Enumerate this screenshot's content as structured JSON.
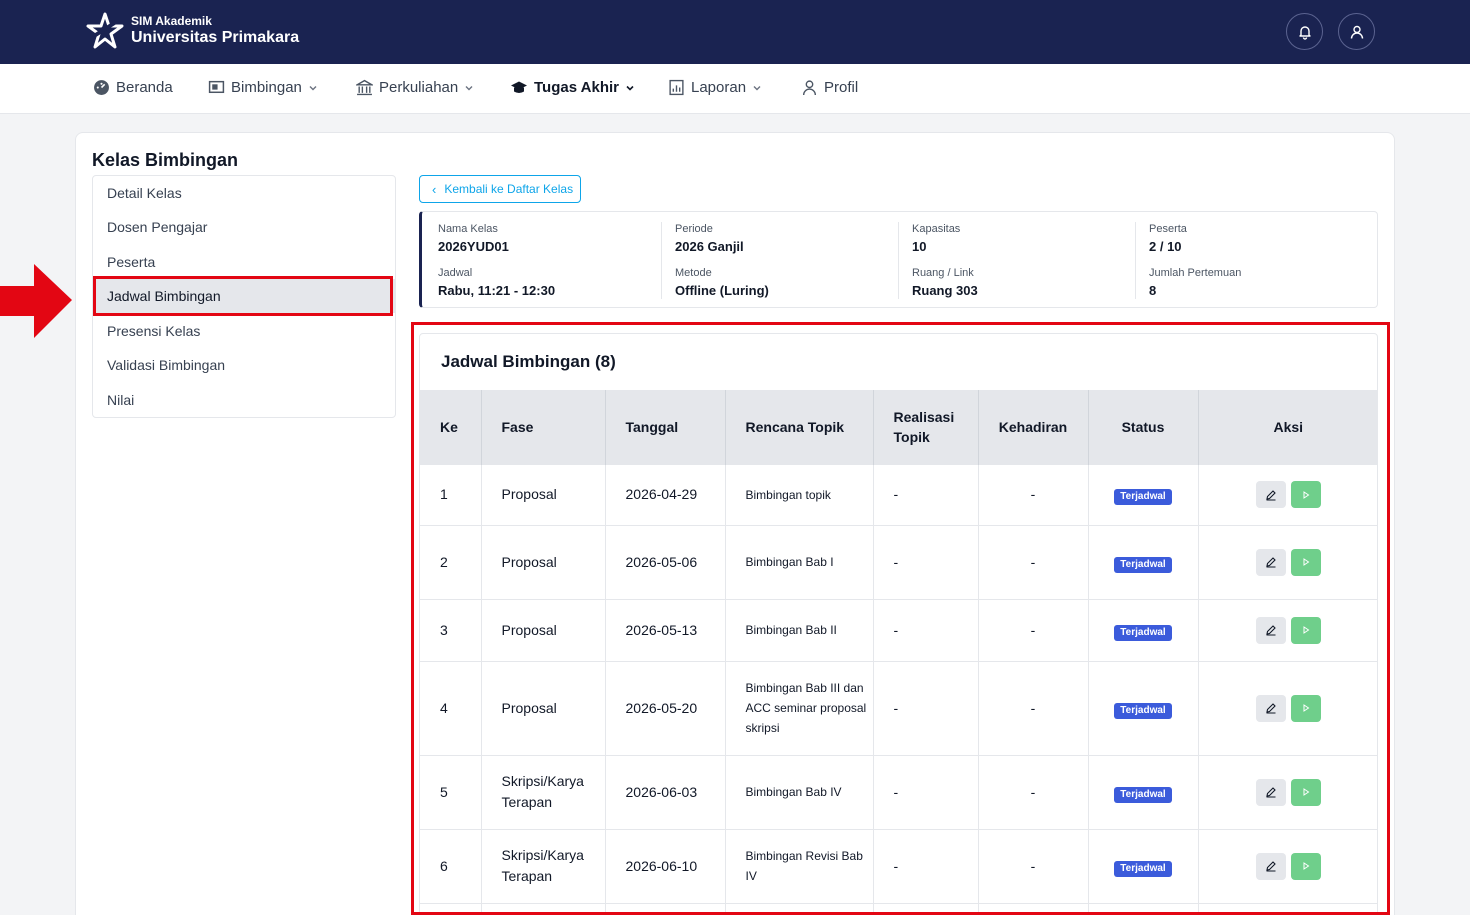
{
  "header": {
    "app_sub": "SIM Akademik",
    "app_name": "Universitas Primakara",
    "notification_icon": "bell-icon",
    "user_icon": "user-icon"
  },
  "nav": {
    "items": [
      {
        "label": "Beranda",
        "icon": "dashboard-icon"
      },
      {
        "label": "Bimbingan",
        "icon": "presentation-icon"
      },
      {
        "label": "Perkuliahan",
        "icon": "building-icon"
      },
      {
        "label": "Tugas Akhir",
        "icon": "graduation-cap-icon",
        "active": true
      },
      {
        "label": "Laporan",
        "icon": "report-icon"
      },
      {
        "label": "Profil",
        "icon": "person-icon"
      }
    ]
  },
  "page": {
    "title": "Kelas Bimbingan",
    "back_label": "Kembali ke Daftar Kelas"
  },
  "side_menu": {
    "items": [
      {
        "label": "Detail Kelas"
      },
      {
        "label": "Dosen Pengajar"
      },
      {
        "label": "Peserta"
      },
      {
        "label": "Jadwal Bimbingan",
        "active": true
      },
      {
        "label": "Presensi Kelas"
      },
      {
        "label": "Validasi Bimbingan"
      },
      {
        "label": "Nilai"
      }
    ]
  },
  "info": {
    "fields": [
      {
        "label": "Nama Kelas",
        "value": "2026YUD01"
      },
      {
        "label": "Periode",
        "value": "2026 Ganjil"
      },
      {
        "label": "Kapasitas",
        "value": "10"
      },
      {
        "label": "Peserta",
        "value": "2 / 10"
      },
      {
        "label": "Jadwal",
        "value": "Rabu, 11:21 - 12:30"
      },
      {
        "label": "Metode",
        "value": "Offline (Luring)"
      },
      {
        "label": "Ruang / Link",
        "value": "Ruang 303"
      },
      {
        "label": "Jumlah Pertemuan",
        "value": "8"
      }
    ]
  },
  "schedule": {
    "title": "Jadwal Bimbingan (8)",
    "columns": [
      "Ke",
      "Fase",
      "Tanggal",
      "Rencana Topik",
      "Realisasi Topik",
      "Kehadiran",
      "Status",
      "Aksi"
    ],
    "rows": [
      {
        "ke": "1",
        "fase": "Proposal",
        "tanggal": "2026-04-29",
        "rencana": "Bimbingan topik",
        "realisasi": "-",
        "kehadiran": "-",
        "status": "Terjadwal"
      },
      {
        "ke": "2",
        "fase": "Proposal",
        "tanggal": "2026-05-06",
        "rencana": "Bimbingan Bab I",
        "realisasi": "-",
        "kehadiran": "-",
        "status": "Terjadwal"
      },
      {
        "ke": "3",
        "fase": "Proposal",
        "tanggal": "2026-05-13",
        "rencana": "Bimbingan Bab II",
        "realisasi": "-",
        "kehadiran": "-",
        "status": "Terjadwal"
      },
      {
        "ke": "4",
        "fase": "Proposal",
        "tanggal": "2026-05-20",
        "rencana": "Bimbingan Bab III dan ACC seminar proposal skripsi",
        "realisasi": "-",
        "kehadiran": "-",
        "status": "Terjadwal"
      },
      {
        "ke": "5",
        "fase": "Skripsi/Karya Terapan",
        "tanggal": "2026-06-03",
        "rencana": "Bimbingan Bab IV",
        "realisasi": "-",
        "kehadiran": "-",
        "status": "Terjadwal"
      },
      {
        "ke": "6",
        "fase": "Skripsi/Karya Terapan",
        "tanggal": "2026-06-10",
        "rencana": "Bimbingan Revisi Bab IV",
        "realisasi": "-",
        "kehadiran": "-",
        "status": "Terjadwal"
      }
    ]
  },
  "colors": {
    "header_bg": "#1a2351",
    "highlight": "#e30613",
    "badge": "#3b5bdb",
    "play_button": "#6fcf8b",
    "back_link": "#0ea5e9"
  }
}
